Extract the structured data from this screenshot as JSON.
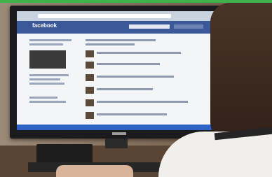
{
  "screen": {
    "logo_text": "facebook"
  },
  "colors": {
    "facebook_blue": "#3b5998",
    "taskbar_blue": "#2f62c7",
    "frame_green": "#3fb24a"
  }
}
